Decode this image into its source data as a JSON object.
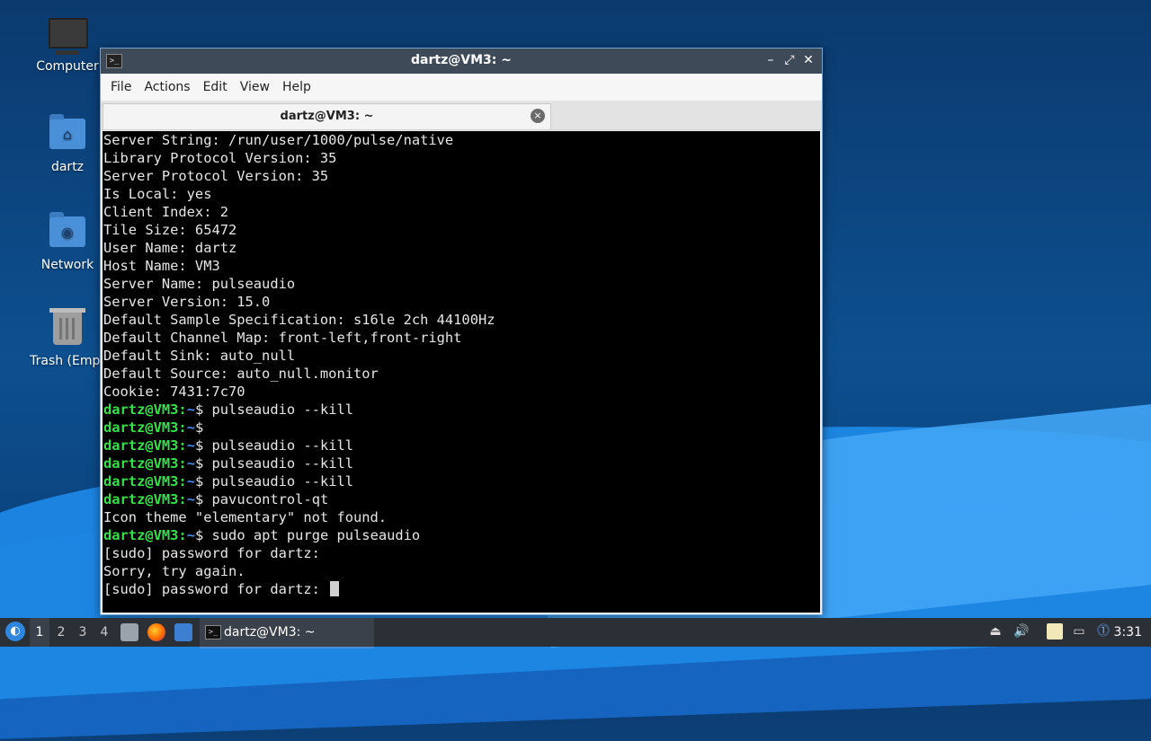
{
  "desktop": {
    "icons": [
      {
        "label": "Computer",
        "icon": "computer-icon"
      },
      {
        "label": "dartz",
        "icon": "home-folder-icon"
      },
      {
        "label": "Network",
        "icon": "network-folder-icon"
      },
      {
        "label": "Trash (Empt",
        "icon": "trash-icon"
      }
    ]
  },
  "window": {
    "title": "dartz@VM3: ~",
    "controls": {
      "minimize": "–",
      "maximize": "⤢",
      "close": "✕"
    },
    "menu": [
      "File",
      "Actions",
      "Edit",
      "View",
      "Help"
    ],
    "tab": {
      "label": "dartz@VM3: ~",
      "close": "×"
    }
  },
  "terminal": {
    "prompt_user": "dartz@VM3",
    "prompt_path": "~",
    "lines": [
      {
        "type": "out",
        "text": "Server String: /run/user/1000/pulse/native"
      },
      {
        "type": "out",
        "text": "Library Protocol Version: 35"
      },
      {
        "type": "out",
        "text": "Server Protocol Version: 35"
      },
      {
        "type": "out",
        "text": "Is Local: yes"
      },
      {
        "type": "out",
        "text": "Client Index: 2"
      },
      {
        "type": "out",
        "text": "Tile Size: 65472"
      },
      {
        "type": "out",
        "text": "User Name: dartz"
      },
      {
        "type": "out",
        "text": "Host Name: VM3"
      },
      {
        "type": "out",
        "text": "Server Name: pulseaudio"
      },
      {
        "type": "out",
        "text": "Server Version: 15.0"
      },
      {
        "type": "out",
        "text": "Default Sample Specification: s16le 2ch 44100Hz"
      },
      {
        "type": "out",
        "text": "Default Channel Map: front-left,front-right"
      },
      {
        "type": "out",
        "text": "Default Sink: auto_null"
      },
      {
        "type": "out",
        "text": "Default Source: auto_null.monitor"
      },
      {
        "type": "out",
        "text": "Cookie: 7431:7c70"
      },
      {
        "type": "cmd",
        "text": "pulseaudio --kill"
      },
      {
        "type": "cmd",
        "text": ""
      },
      {
        "type": "cmd",
        "text": "pulseaudio --kill"
      },
      {
        "type": "cmd",
        "text": "pulseaudio --kill"
      },
      {
        "type": "cmd",
        "text": "pulseaudio --kill"
      },
      {
        "type": "cmd",
        "text": "pavucontrol-qt"
      },
      {
        "type": "out",
        "text": "Icon theme \"elementary\" not found."
      },
      {
        "type": "cmd",
        "text": "sudo apt purge pulseaudio"
      },
      {
        "type": "out",
        "text": "[sudo] password for dartz:"
      },
      {
        "type": "out",
        "text": "Sorry, try again."
      },
      {
        "type": "input",
        "text": "[sudo] password for dartz: "
      }
    ]
  },
  "taskbar": {
    "start_icon": "lubuntu-start-icon",
    "workspaces": [
      "1",
      "2",
      "3",
      "4"
    ],
    "active_workspace": "1",
    "quicklaunch": [
      "file-manager-icon",
      "firefox-icon",
      "show-desktop-icon"
    ],
    "task_label": "dartz@VM3: ~",
    "tray": [
      "eject-icon",
      "volume-icon",
      "clipboard-icon",
      "network-icon",
      "update-notifier-icon"
    ],
    "clock": "3:31"
  },
  "colors": {
    "prompt_user": "#36e04a",
    "prompt_path": "#4a8cf0",
    "accent": "#4a90d9"
  }
}
